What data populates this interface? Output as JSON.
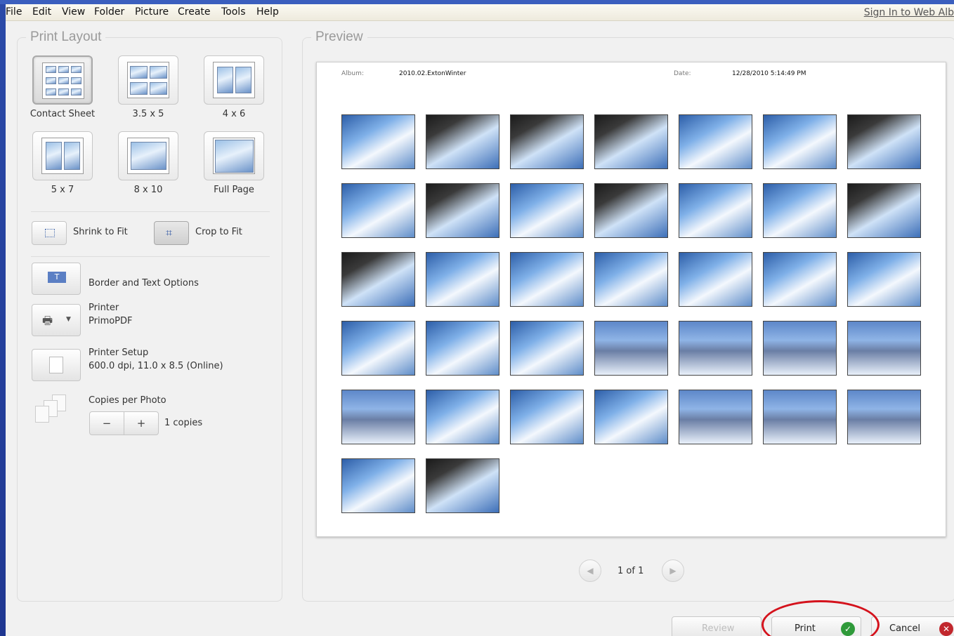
{
  "menu": [
    "File",
    "Edit",
    "View",
    "Folder",
    "Picture",
    "Create",
    "Tools",
    "Help"
  ],
  "signin": "Sign In to Web Alb",
  "print_layout": {
    "title": "Print Layout",
    "options": [
      {
        "label": "Contact Sheet",
        "selected": true
      },
      {
        "label": "3.5 x 5",
        "selected": false
      },
      {
        "label": "4 x 6",
        "selected": false
      },
      {
        "label": "5 x 7",
        "selected": false
      },
      {
        "label": "8 x 10",
        "selected": false
      },
      {
        "label": "Full Page",
        "selected": false
      }
    ],
    "shrink_to_fit": "Shrink to Fit",
    "crop_to_fit": "Crop to Fit",
    "crop_selected": true,
    "border_text": "Border and Text Options",
    "printer_label": "Printer",
    "printer_name": "PrimoPDF",
    "setup_label": "Printer Setup",
    "setup_detail": "600.0 dpi, 11.0 x 8.5 (Online)",
    "copies_label": "Copies per Photo",
    "copies_minus": "−",
    "copies_plus": "+",
    "copies_value": "1 copies"
  },
  "preview": {
    "title": "Preview",
    "album_label": "Album:",
    "album_value": "2010.02.ExtonWinter",
    "date_label": "Date:",
    "date_value": "12/28/2010 5:14:49 PM",
    "photo_count": 37,
    "page_indicator": "1 of 1",
    "prev_icon": "◀",
    "next_icon": "▶"
  },
  "footer": {
    "review": "Review",
    "print": "Print",
    "cancel": "Cancel",
    "check_icon": "✓",
    "x_icon": "✕"
  },
  "colors": {
    "print_highlight": "#d4121c",
    "check_green": "#2f9a3a",
    "cancel_red": "#c1272d"
  }
}
